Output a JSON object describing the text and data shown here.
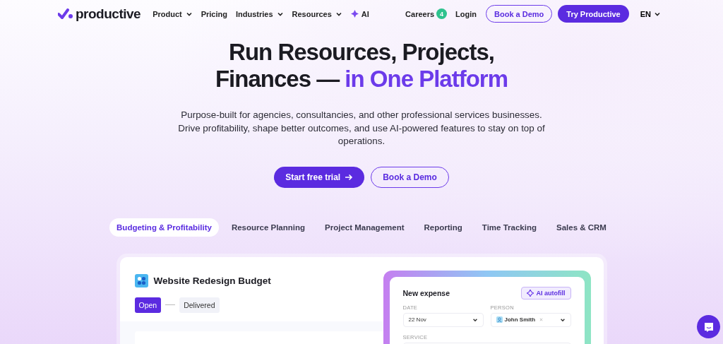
{
  "nav": {
    "logo": "productive",
    "items": [
      {
        "label": "Product",
        "dropdown": true
      },
      {
        "label": "Pricing",
        "dropdown": false
      },
      {
        "label": "Industries",
        "dropdown": true
      },
      {
        "label": "Resources",
        "dropdown": true
      },
      {
        "label": "AI",
        "dropdown": false,
        "kind": "ai"
      }
    ],
    "careers": {
      "label": "Careers",
      "badge": "4"
    },
    "login": "Login",
    "demo_button": "Book a Demo",
    "try_button": "Try Productive",
    "language": "EN"
  },
  "hero": {
    "title_line1": "Run Resources, Projects,",
    "title_line2": "Finances — ",
    "title_highlight": "in One Platform",
    "description": "Purpose-built for agencies, consultancies, and other professional services businesses. Drive profitability, shape better outcomes, and use AI-powered features to stay on top of operations.",
    "primary_button": "Start free trial",
    "secondary_button": "Book a Demo"
  },
  "tabs": [
    {
      "label": "Budgeting & Profitability",
      "selected": true
    },
    {
      "label": "Resource Planning",
      "selected": false
    },
    {
      "label": "Project Management",
      "selected": false
    },
    {
      "label": "Reporting",
      "selected": false
    },
    {
      "label": "Time Tracking",
      "selected": false
    },
    {
      "label": "Sales & CRM",
      "selected": false
    }
  ],
  "budget": {
    "title": "Website Redesign Budget",
    "stages": [
      {
        "label": "Open",
        "selected": true
      },
      {
        "label": "Delivered",
        "selected": false
      }
    ]
  },
  "expense": {
    "title": "New expense",
    "ai_button": "AI autofill",
    "date_label": "DATE",
    "date_value": "22 Nov",
    "person_label": "PERSON",
    "person_value": "John Smith",
    "service_label": "SERVICE"
  }
}
